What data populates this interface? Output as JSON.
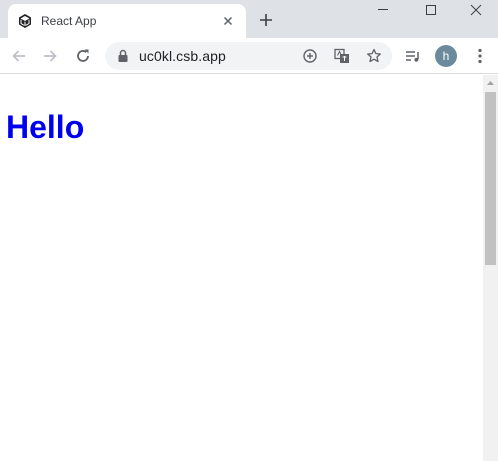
{
  "tab": {
    "title": "React App",
    "favicon": "codesandbox-icon"
  },
  "address_bar": {
    "url": "uc0kl.csb.app"
  },
  "profile": {
    "initial": "h",
    "color": "#6b8a9c"
  },
  "page": {
    "heading": "Hello",
    "heading_color": "#0000ee"
  },
  "scrollbar": {
    "thumb_fraction": 0.45
  }
}
